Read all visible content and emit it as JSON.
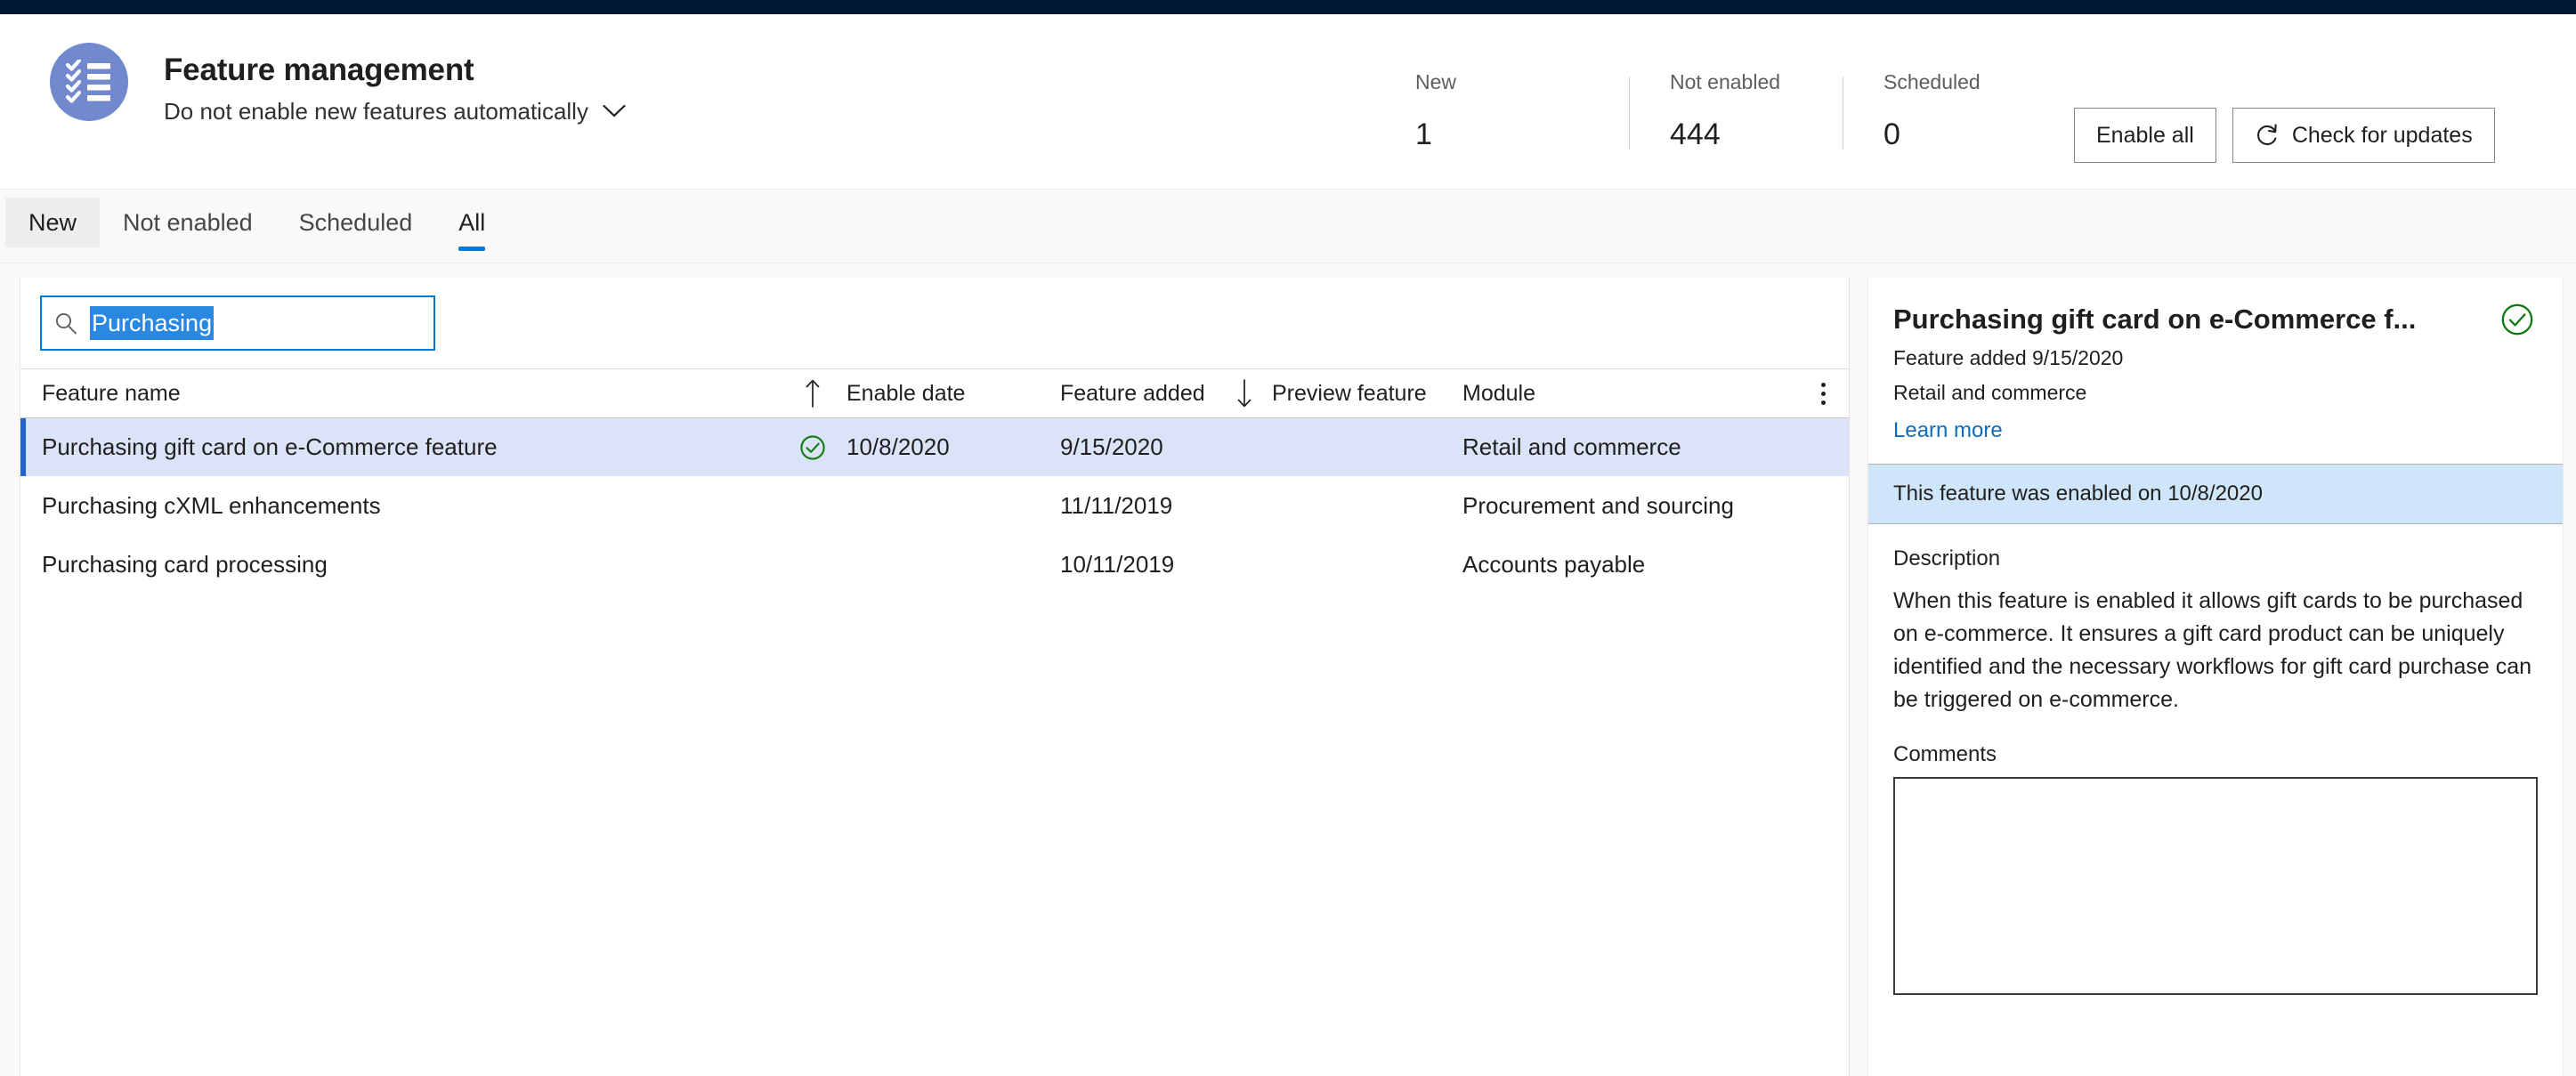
{
  "topbar": {
    "color": "#001832"
  },
  "header": {
    "avatar_icon": "checklist-icon",
    "title": "Feature management",
    "subtitle": "Do not enable new features automatically",
    "subtitle_chevron_icon": "chevron-down-icon",
    "stats": [
      {
        "label": "New",
        "value": "1"
      },
      {
        "label": "Not enabled",
        "value": "444"
      },
      {
        "label": "Scheduled",
        "value": "0"
      }
    ],
    "buttons": [
      {
        "label": "Enable all",
        "icon": null
      },
      {
        "label": "Check for updates",
        "icon": "refresh-icon"
      }
    ]
  },
  "tabs": [
    {
      "label": "New",
      "state": "hovered"
    },
    {
      "label": "Not enabled",
      "state": "default"
    },
    {
      "label": "Scheduled",
      "state": "default"
    },
    {
      "label": "All",
      "state": "selected"
    }
  ],
  "search": {
    "icon": "search-icon",
    "value": "Purchasing",
    "placeholder": "Filter",
    "selected": true
  },
  "grid": {
    "columns": [
      {
        "key": "name",
        "label": "Feature name",
        "sort": "ascending",
        "sort_icon": "arrow-up-icon"
      },
      {
        "key": "enable_date",
        "label": "Enable date",
        "sort": null
      },
      {
        "key": "feature_added",
        "label": "Feature added",
        "sort": "descending",
        "sort_icon": "arrow-down-icon"
      },
      {
        "key": "preview_feature",
        "label": "Preview feature",
        "sort": null
      },
      {
        "key": "module",
        "label": "Module",
        "sort": null
      }
    ],
    "overflow_icon": "kebab-menu-icon",
    "rows": [
      {
        "name": "Purchasing gift card on e-Commerce feature",
        "enabled_icon": "green-check-circle-icon",
        "enable_date": "10/8/2020",
        "feature_added": "9/15/2020",
        "preview_feature": "",
        "module": "Retail and commerce",
        "selected": true
      },
      {
        "name": "Purchasing cXML enhancements",
        "enabled_icon": null,
        "enable_date": "",
        "feature_added": "11/11/2019",
        "preview_feature": "",
        "module": "Procurement and sourcing",
        "selected": false
      },
      {
        "name": "Purchasing card processing",
        "enabled_icon": null,
        "enable_date": "",
        "feature_added": "10/11/2019",
        "preview_feature": "",
        "module": "Accounts payable",
        "selected": false
      }
    ]
  },
  "detail": {
    "title": "Purchasing gift card on e-Commerce f...",
    "status_icon": "green-check-circle-icon",
    "added": "Feature added 9/15/2020",
    "module": "Retail and commerce",
    "learn_more": "Learn more",
    "enabled_banner": "This feature was enabled on 10/8/2020",
    "description_label": "Description",
    "description": "When this feature is enabled it allows gift cards to be purchased on e-commerce. It ensures a gift card product can be uniquely identified and the necessary workflows for gift card purchase can be triggered on e-commerce.",
    "comments_label": "Comments",
    "comments_value": "",
    "comments_placeholder": ""
  },
  "colors": {
    "accent": "#0078d4",
    "navy": "#001832",
    "avatar": "#7289ce",
    "selected_row": "#dae3f7",
    "selected_row_bar": "#2564cf",
    "banner": "#cfe6fa",
    "success": "#107c10",
    "link": "#0f6cbd",
    "selection_highlight": "#2b88e0"
  }
}
